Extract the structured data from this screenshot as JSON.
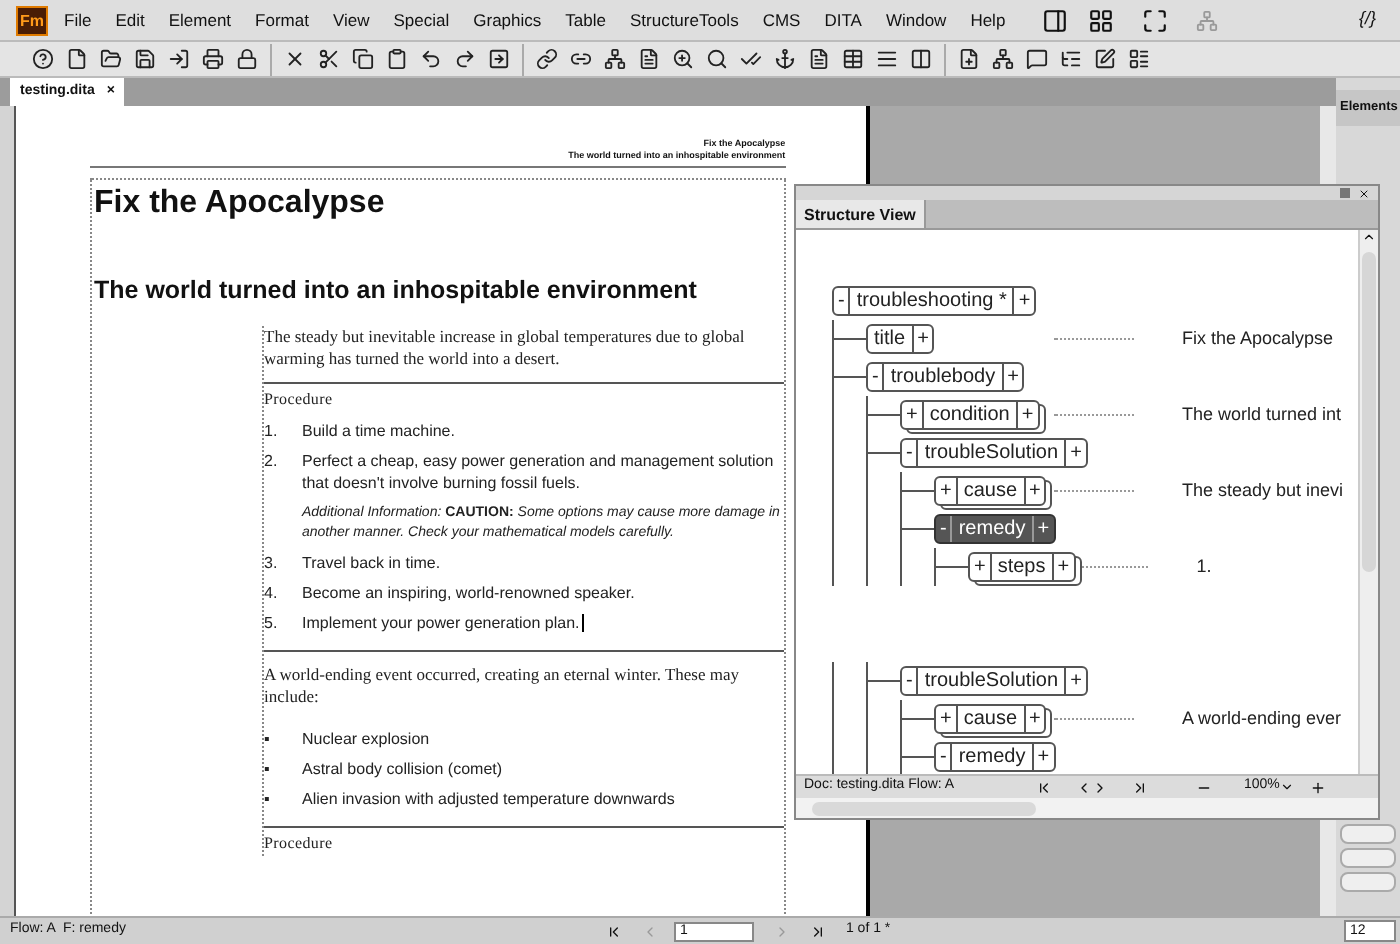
{
  "app": {
    "logo": "Fm"
  },
  "menu": [
    "File",
    "Edit",
    "Element",
    "Format",
    "View",
    "Special",
    "Graphics",
    "Table",
    "StructureTools",
    "CMS",
    "DITA",
    "Window",
    "Help"
  ],
  "menu_right_label": "{/}",
  "tabs": [
    {
      "label": "testing.dita",
      "close": "×",
      "selected": true
    }
  ],
  "elements_panel": {
    "title": "Elements"
  },
  "document": {
    "running_head": [
      "Fix the Apocalypse",
      "The world turned into an inhospitable environment"
    ],
    "title": "Fix the Apocalypse",
    "subtitle": "The world turned into an inhospitable environment",
    "sections": [
      {
        "intro": "The steady but inevitable increase in global temperatures due to global warming has turned the world into a desert.",
        "label": "Procedure",
        "items": [
          {
            "marker": "1.",
            "text": "Build a time machine."
          },
          {
            "marker": "2.",
            "text": "Perfect a cheap, easy power generation and management solution that doesn't involve burning fossil fuels.",
            "note": "*Additional Information:* **CAUTION:** *Some options may cause more damage in another manner. Check your mathematical models carefully.*"
          },
          {
            "marker": "3.",
            "text": "Travel back in time."
          },
          {
            "marker": "4.",
            "text": "Become an inspiring, world-renowned speaker."
          },
          {
            "marker": "5.",
            "text": "Implement your power generation plan.",
            "cursor": true
          }
        ]
      },
      {
        "intro": "A world-ending event occurred, creating an eternal winter. These may include:",
        "items": [
          {
            "marker": "▪",
            "text": "Nuclear explosion"
          },
          {
            "marker": "▪",
            "text": "Astral body collision (comet)"
          },
          {
            "marker": "▪",
            "text": "Alien invasion with adjusted temperature downwards"
          }
        ]
      },
      {
        "label": "Procedure"
      }
    ]
  },
  "structure_view": {
    "title": "Structure View",
    "tree": [
      {
        "name": "troubleshooting *",
        "toggle": "-",
        "add": "+",
        "stacked": false,
        "selected": false,
        "children": [
          {
            "name": "title",
            "add": "+",
            "stacked": false,
            "selected": false,
            "preview": "Fix the Apocalypse"
          },
          {
            "name": "troublebody",
            "toggle": "-",
            "add": "+",
            "stacked": false,
            "selected": false,
            "children": [
              {
                "name": "condition",
                "toggle": "+",
                "add": "+",
                "stacked": true,
                "selected": false,
                "preview": "The world turned int"
              },
              {
                "name": "troubleSolution",
                "toggle": "-",
                "add": "+",
                "stacked": false,
                "selected": false,
                "children": [
                  {
                    "name": "cause",
                    "toggle": "+",
                    "add": "+",
                    "stacked": true,
                    "selected": false,
                    "preview": "The steady but inevi"
                  },
                  {
                    "name": "remedy",
                    "toggle": "-",
                    "add": "+",
                    "stacked": false,
                    "selected": true,
                    "children": [
                      {
                        "name": "steps",
                        "toggle": "+",
                        "add": "+",
                        "stacked": true,
                        "selected": false,
                        "preview": "1."
                      }
                    ]
                  }
                ]
              },
              {
                "name": "troubleSolution",
                "toggle": "-",
                "add": "+",
                "stacked": false,
                "selected": false,
                "gap": true,
                "children": [
                  {
                    "name": "cause",
                    "toggle": "+",
                    "add": "+",
                    "stacked": true,
                    "selected": false,
                    "preview": "A world-ending ever"
                  },
                  {
                    "name": "remedy",
                    "toggle": "-",
                    "add": "+",
                    "stacked": false,
                    "selected": false
                  }
                ]
              }
            ]
          }
        ]
      }
    ],
    "status": "Doc: testing.dita Flow: A",
    "zoom": "100%"
  },
  "status_bar": {
    "flow": "Flow: A  F: remedy",
    "page": "1",
    "page_count": "1 of 1 *",
    "field": "12"
  }
}
